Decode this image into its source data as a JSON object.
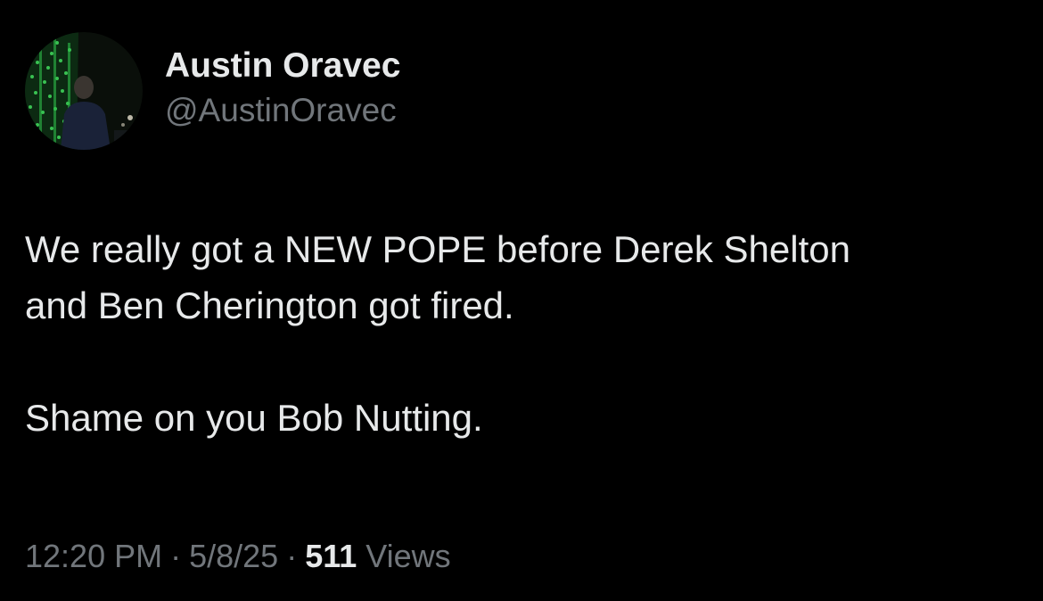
{
  "author": {
    "display_name": "Austin Oravec",
    "handle": "@AustinOravec"
  },
  "tweet": {
    "lines": [
      "We really got a NEW POPE before Derek Shelton",
      "and Ben Cherington got fired."
    ],
    "second_paragraph": "Shame on you Bob Nutting."
  },
  "meta": {
    "time": "12:20 PM",
    "separator": "·",
    "date": "5/8/25",
    "views_count": "511",
    "views_label": "Views"
  },
  "colors": {
    "background": "#000000",
    "primary_text": "#e7e9ea",
    "secondary_text": "#71767b",
    "avatar_lights": "#2fbf4a"
  }
}
